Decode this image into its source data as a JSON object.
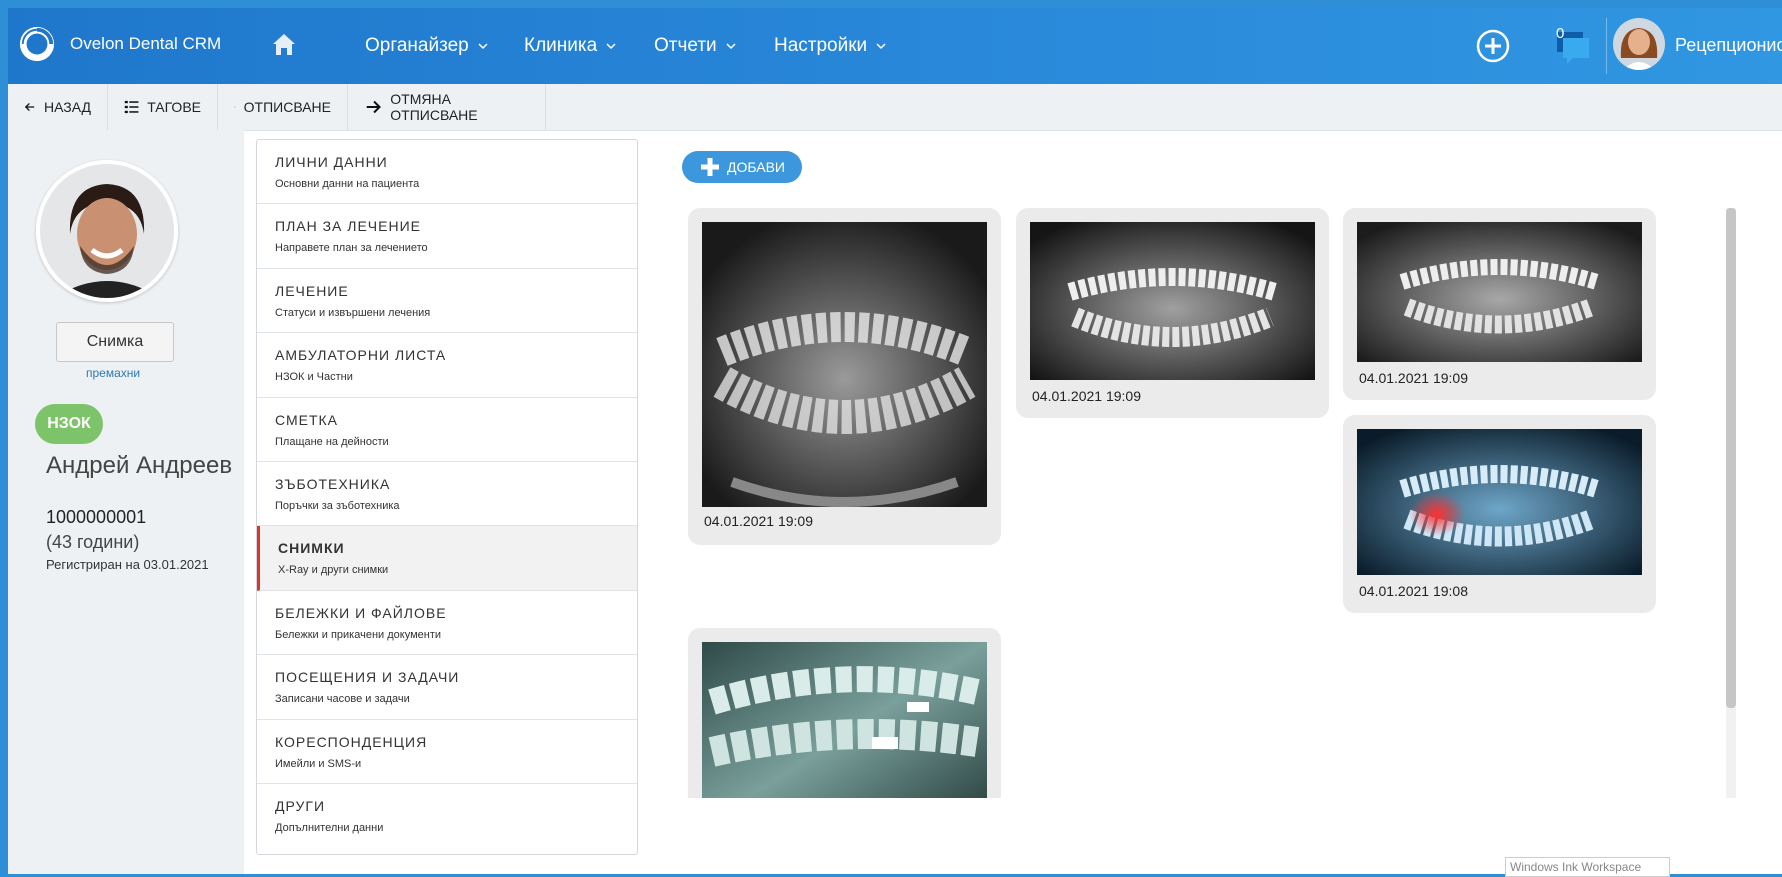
{
  "app": {
    "title": "Ovelon Dental CRM"
  },
  "topnav": {
    "items": [
      {
        "label": "Органайзер"
      },
      {
        "label": "Клиника"
      },
      {
        "label": "Отчети"
      },
      {
        "label": "Настройки"
      }
    ],
    "notifications_count": "0",
    "user_role": "Рецепционист"
  },
  "toolbar": {
    "back": "Назад",
    "tags": "Тагове",
    "checkout": "Отписване",
    "cancel_checkout": "Отмяна отписване"
  },
  "patient": {
    "photo_button": "Снимка",
    "remove_link": "премахни",
    "badge": "НЗОК",
    "name": "Андрей Андреев",
    "id": "1000000001",
    "age": "(43 години)",
    "registered": "Регистриран на 03.01.2021"
  },
  "menu": {
    "items": [
      {
        "title": "Лични данни",
        "subtitle": "Основни данни на пациента"
      },
      {
        "title": "План за лечение",
        "subtitle": "Направете план за лечението"
      },
      {
        "title": "Лечение",
        "subtitle": "Статуси и извършени лечения"
      },
      {
        "title": "Амбулаторни листа",
        "subtitle": "НЗОК и Частни"
      },
      {
        "title": "Сметка",
        "subtitle": "Плащане на дейности"
      },
      {
        "title": "Зъботехника",
        "subtitle": "Поръчки за зъботехника"
      },
      {
        "title": "Снимки",
        "subtitle": "X-Ray и други снимки"
      },
      {
        "title": "Бележки и файлове",
        "subtitle": "Бележки и прикачени документи"
      },
      {
        "title": "Посещения и задачи",
        "subtitle": "Записани часове и задачи"
      },
      {
        "title": "Кореспонденция",
        "subtitle": "Имейли и SMS-и"
      },
      {
        "title": "Други",
        "subtitle": "Допълнителни данни"
      }
    ],
    "active_index": 6
  },
  "gallery": {
    "add_button": "Добави",
    "images": [
      {
        "timestamp": "04.01.2021 19:09"
      },
      {
        "timestamp": "04.01.2021 19:09"
      },
      {
        "timestamp": "04.01.2021 19:09"
      },
      {
        "timestamp": "04.01.2021 19:08"
      },
      {
        "timestamp": ""
      }
    ]
  },
  "ink_hint": "Windows Ink Workspace"
}
